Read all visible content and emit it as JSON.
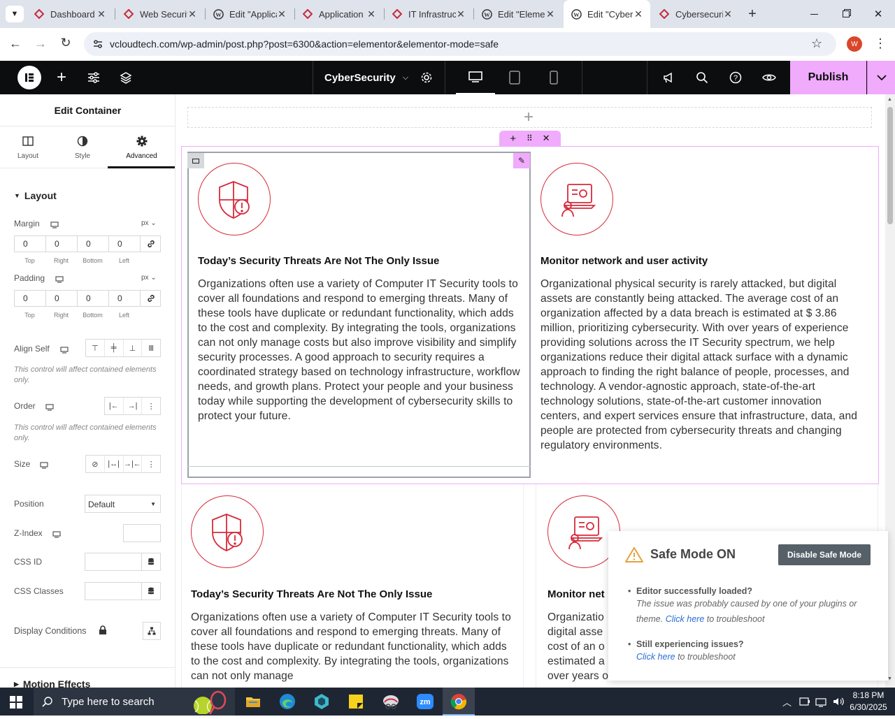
{
  "browser": {
    "tabs": [
      {
        "title": "Dashboard",
        "icon": "wp-ruby-icon"
      },
      {
        "title": "Web Security",
        "icon": "wp-ruby-icon"
      },
      {
        "title": "Edit \"Application\"",
        "icon": "wordpress-icon"
      },
      {
        "title": "Application",
        "icon": "wp-ruby-icon"
      },
      {
        "title": "IT Infrastructure",
        "icon": "wp-ruby-icon"
      },
      {
        "title": "Edit \"Elementor\"",
        "icon": "wordpress-icon"
      },
      {
        "title": "Edit \"CyberSecurity\"",
        "icon": "wordpress-icon",
        "active": true
      },
      {
        "title": "Cybersecurity",
        "icon": "wp-ruby-icon"
      }
    ],
    "url": "vcloudtech.com/wp-admin/post.php?post=6300&action=elementor&elementor-mode=safe",
    "profile_letter": "W"
  },
  "editor": {
    "page_name": "CyberSecurity",
    "publish_label": "Publish"
  },
  "panel": {
    "title": "Edit Container",
    "tabs": [
      {
        "label": "Layout",
        "icon": "layout-columns-icon"
      },
      {
        "label": "Style",
        "icon": "half-circle-icon"
      },
      {
        "label": "Advanced",
        "icon": "gear-icon",
        "active": true
      }
    ],
    "section_layout": "Layout",
    "margin": {
      "label": "Margin",
      "unit": "px",
      "values": [
        "0",
        "0",
        "0",
        "0"
      ]
    },
    "padding": {
      "label": "Padding",
      "unit": "px",
      "values": [
        "0",
        "0",
        "0",
        "0"
      ]
    },
    "dim_labels": [
      "Top",
      "Right",
      "Bottom",
      "Left"
    ],
    "align_self": "Align Self",
    "hint": "This control will affect contained elements only.",
    "order": "Order",
    "size": "Size",
    "position": {
      "label": "Position",
      "value": "Default"
    },
    "zindex": "Z-Index",
    "css_id": "CSS ID",
    "css_classes": "CSS Classes",
    "display_conditions": "Display Conditions",
    "motion_effects": "Motion Effects"
  },
  "canvas": {
    "cards": [
      {
        "heading": "Today’s Security Threats Are Not The Only Issue",
        "body": "Organizations often use a variety of Computer IT Security tools to cover all foundations and respond to emerging threats. Many of these tools have duplicate or redundant functionality, which adds to the cost and complexity. By integrating the tools, organizations can not only manage costs but also improve visibility and simplify security processes. A good approach to security requires a coordinated strategy based on technology infrastructure, workflow needs, and growth plans. Protect your people and your business today while supporting the development of cybersecurity skills to protect your future."
      },
      {
        "heading": "Monitor network and user activity",
        "body": "Organizational physical security is rarely attacked, but digital assets are constantly being attacked. The average cost of an organization affected by a data breach is estimated at $ 3.86 million, prioritizing cybersecurity. With over years of experience providing solutions across the IT Security spectrum, we help organizations reduce their digital attack surface with a dynamic approach to finding the right balance of people, processes, and technology. A vendor-agnostic approach, state-of-the-art technology solutions, state-of-the-art customer innovation centers, and expert services ensure that infrastructure, data, and people are protected from cybersecurity threats and changing regulatory environments."
      },
      {
        "heading": "Today’s Security Threats Are Not The Only Issue",
        "body": "Organizations often use a variety of Computer IT Security tools to cover all foundations and respond to emerging threats. Many of these tools have duplicate or redundant functionality, which adds to the cost and complexity. By integrating the tools, organizations can not only manage"
      },
      {
        "heading": "Monitor net",
        "lines": [
          "Organizatio",
          "digital asse",
          "cost of an o",
          "estimated a",
          "over years o"
        ]
      }
    ]
  },
  "safe_mode": {
    "title": "Safe Mode ON",
    "disable_label": "Disable Safe Mode",
    "q1": "Editor successfully loaded?",
    "a1_pre": "The issue was probably caused by one of your plugins or theme.",
    "a1_link": "Click here",
    "a1_post": "to troubleshoot",
    "q2": "Still experiencing issues?",
    "a2_link": "Click here",
    "a2_post": "to troubleshoot"
  },
  "taskbar": {
    "search_placeholder": "Type here to search",
    "time": "8:18 PM",
    "date": "6/30/2025"
  },
  "colors": {
    "accent": "#d62b3b",
    "publish": "#f0abfc",
    "container_outline": "#f0abfc"
  }
}
